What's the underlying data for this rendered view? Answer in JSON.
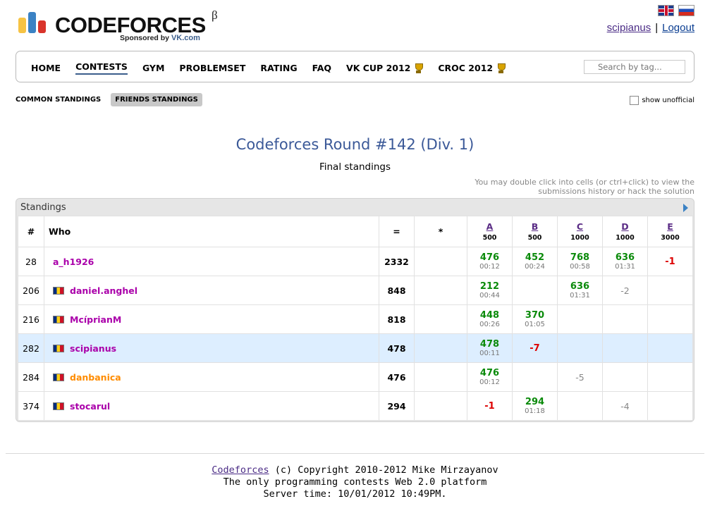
{
  "header": {
    "logo_text": "CODEFORCES",
    "logo_beta": "β",
    "sponsored_by": "Sponsored by",
    "sponsor_name": "VK.com",
    "user": "scipianus",
    "logout": "Logout",
    "separator": "|"
  },
  "menu": {
    "items": [
      {
        "label": "HOME"
      },
      {
        "label": "CONTESTS"
      },
      {
        "label": "GYM"
      },
      {
        "label": "PROBLEMSET"
      },
      {
        "label": "RATING"
      },
      {
        "label": "FAQ"
      },
      {
        "label": "VK CUP 2012"
      },
      {
        "label": "CROC 2012"
      }
    ],
    "active_index": 1,
    "search_placeholder": "Search by tag..."
  },
  "subtabs": {
    "common": "COMMON STANDINGS",
    "friends": "FRIENDS STANDINGS",
    "active": "friends",
    "show_unofficial": "show unofficial"
  },
  "contest": {
    "title": "Codeforces Round #142 (Div. 1)",
    "status": "Final standings",
    "hint_line1": "You may double click into cells (or ctrl+click) to view the",
    "hint_line2": "submissions history or hack the solution"
  },
  "standings": {
    "caption": "Standings",
    "columns": {
      "rank": "#",
      "who": "Who",
      "points": "=",
      "penalty": "*"
    },
    "problems": [
      {
        "letter": "A",
        "points": "500"
      },
      {
        "letter": "B",
        "points": "500"
      },
      {
        "letter": "C",
        "points": "1000"
      },
      {
        "letter": "D",
        "points": "1000"
      },
      {
        "letter": "E",
        "points": "3000"
      }
    ],
    "rows": [
      {
        "rank": "28",
        "handle": "a_h1926",
        "flag": false,
        "color": "#aa00aa",
        "points": "2332",
        "penalty": "",
        "me": false,
        "cells": [
          {
            "v": "476",
            "t": "00:12",
            "k": "acc"
          },
          {
            "v": "452",
            "t": "00:24",
            "k": "acc"
          },
          {
            "v": "768",
            "t": "00:58",
            "k": "acc"
          },
          {
            "v": "636",
            "t": "01:31",
            "k": "acc"
          },
          {
            "v": "-1",
            "t": "",
            "k": "rej"
          }
        ]
      },
      {
        "rank": "206",
        "handle": "daniel.anghel",
        "flag": true,
        "color": "#aa00aa",
        "points": "848",
        "penalty": "",
        "me": false,
        "cells": [
          {
            "v": "212",
            "t": "00:44",
            "k": "acc"
          },
          {
            "v": "",
            "t": "",
            "k": ""
          },
          {
            "v": "636",
            "t": "01:31",
            "k": "acc"
          },
          {
            "v": "-2",
            "t": "",
            "k": "fail"
          },
          {
            "v": "",
            "t": "",
            "k": ""
          }
        ]
      },
      {
        "rank": "216",
        "handle": "McíprianM",
        "flag": true,
        "color": "#aa00aa",
        "points": "818",
        "penalty": "",
        "me": false,
        "cells": [
          {
            "v": "448",
            "t": "00:26",
            "k": "acc"
          },
          {
            "v": "370",
            "t": "01:05",
            "k": "acc"
          },
          {
            "v": "",
            "t": "",
            "k": ""
          },
          {
            "v": "",
            "t": "",
            "k": ""
          },
          {
            "v": "",
            "t": "",
            "k": ""
          }
        ]
      },
      {
        "rank": "282",
        "handle": "scipianus",
        "flag": true,
        "color": "#aa00aa",
        "points": "478",
        "penalty": "",
        "me": true,
        "cells": [
          {
            "v": "478",
            "t": "00:11",
            "k": "acc"
          },
          {
            "v": "-7",
            "t": "",
            "k": "rej"
          },
          {
            "v": "",
            "t": "",
            "k": ""
          },
          {
            "v": "",
            "t": "",
            "k": ""
          },
          {
            "v": "",
            "t": "",
            "k": ""
          }
        ]
      },
      {
        "rank": "284",
        "handle": "danbanica",
        "flag": true,
        "color": "#ff8c00",
        "points": "476",
        "penalty": "",
        "me": false,
        "cells": [
          {
            "v": "476",
            "t": "00:12",
            "k": "acc"
          },
          {
            "v": "",
            "t": "",
            "k": ""
          },
          {
            "v": "-5",
            "t": "",
            "k": "fail"
          },
          {
            "v": "",
            "t": "",
            "k": ""
          },
          {
            "v": "",
            "t": "",
            "k": ""
          }
        ]
      },
      {
        "rank": "374",
        "handle": "stocarul",
        "flag": true,
        "color": "#aa00aa",
        "points": "294",
        "penalty": "",
        "me": false,
        "cells": [
          {
            "v": "-1",
            "t": "",
            "k": "rej"
          },
          {
            "v": "294",
            "t": "01:18",
            "k": "acc"
          },
          {
            "v": "",
            "t": "",
            "k": ""
          },
          {
            "v": "-4",
            "t": "",
            "k": "fail"
          },
          {
            "v": "",
            "t": "",
            "k": ""
          }
        ]
      }
    ]
  },
  "footer": {
    "link": "Codeforces",
    "copyright": " (c) Copyright 2010-2012 Mike Mirzayanov",
    "line2": "The only programming contests Web 2.0 platform",
    "line3": "Server time: 10/01/2012 10:49PM."
  },
  "colors": {
    "title_blue": "#3b5998",
    "accepted_green": "#0a8a0a",
    "rejected_red": "#dd0000",
    "highlight_row": "#ddeeff",
    "logo_bar_yellow": "#f6c344",
    "logo_bar_blue": "#3b82c4",
    "logo_bar_red": "#d9342b"
  }
}
